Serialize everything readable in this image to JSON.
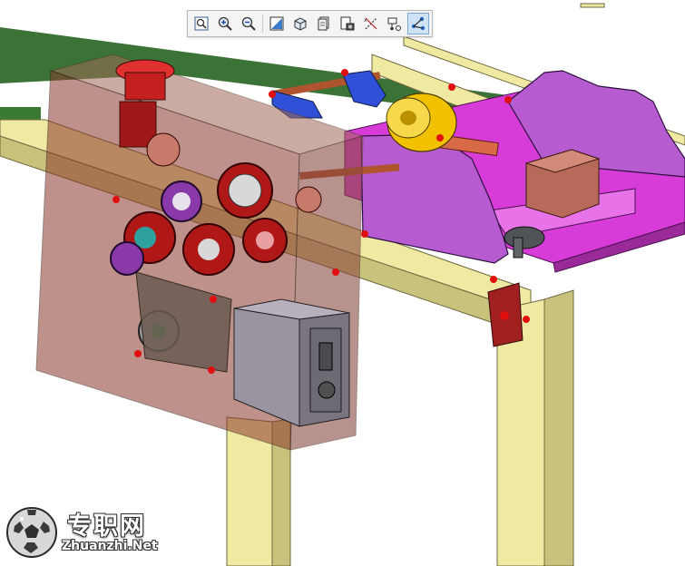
{
  "viewer": {
    "toolbar": {
      "buttons": [
        {
          "id": "zoom-fit",
          "icon": "zoom-fit-icon"
        },
        {
          "id": "zoom-in",
          "icon": "zoom-in-icon"
        },
        {
          "id": "zoom-out",
          "icon": "zoom-out-icon"
        },
        {
          "id": "repaint",
          "icon": "repaint-icon"
        },
        {
          "id": "display-style",
          "icon": "display-style-icon"
        },
        {
          "id": "saved-views",
          "icon": "saved-views-icon"
        },
        {
          "id": "view-manager",
          "icon": "view-manager-icon"
        },
        {
          "id": "datum-display",
          "icon": "datum-display-icon"
        },
        {
          "id": "spin-center",
          "icon": "spin-center-icon"
        },
        {
          "id": "annotation-display",
          "icon": "annotation-display-icon",
          "active": true
        }
      ]
    }
  },
  "watermark": {
    "brand_cn": "专职网",
    "brand_en": "Zhuanzhi.Net"
  },
  "colors": {
    "frame": "#f0e9a2",
    "frame_dark": "#c9c27c",
    "belt_green": "#2f6b2a",
    "magenta": "#d83cd8",
    "purple": "#b65cd0",
    "housing": "#8a3a2e",
    "gear_red": "#b01818",
    "roller_yellow": "#f2c200",
    "control_box": "#9a93a0",
    "fasteners": "#e01010"
  }
}
